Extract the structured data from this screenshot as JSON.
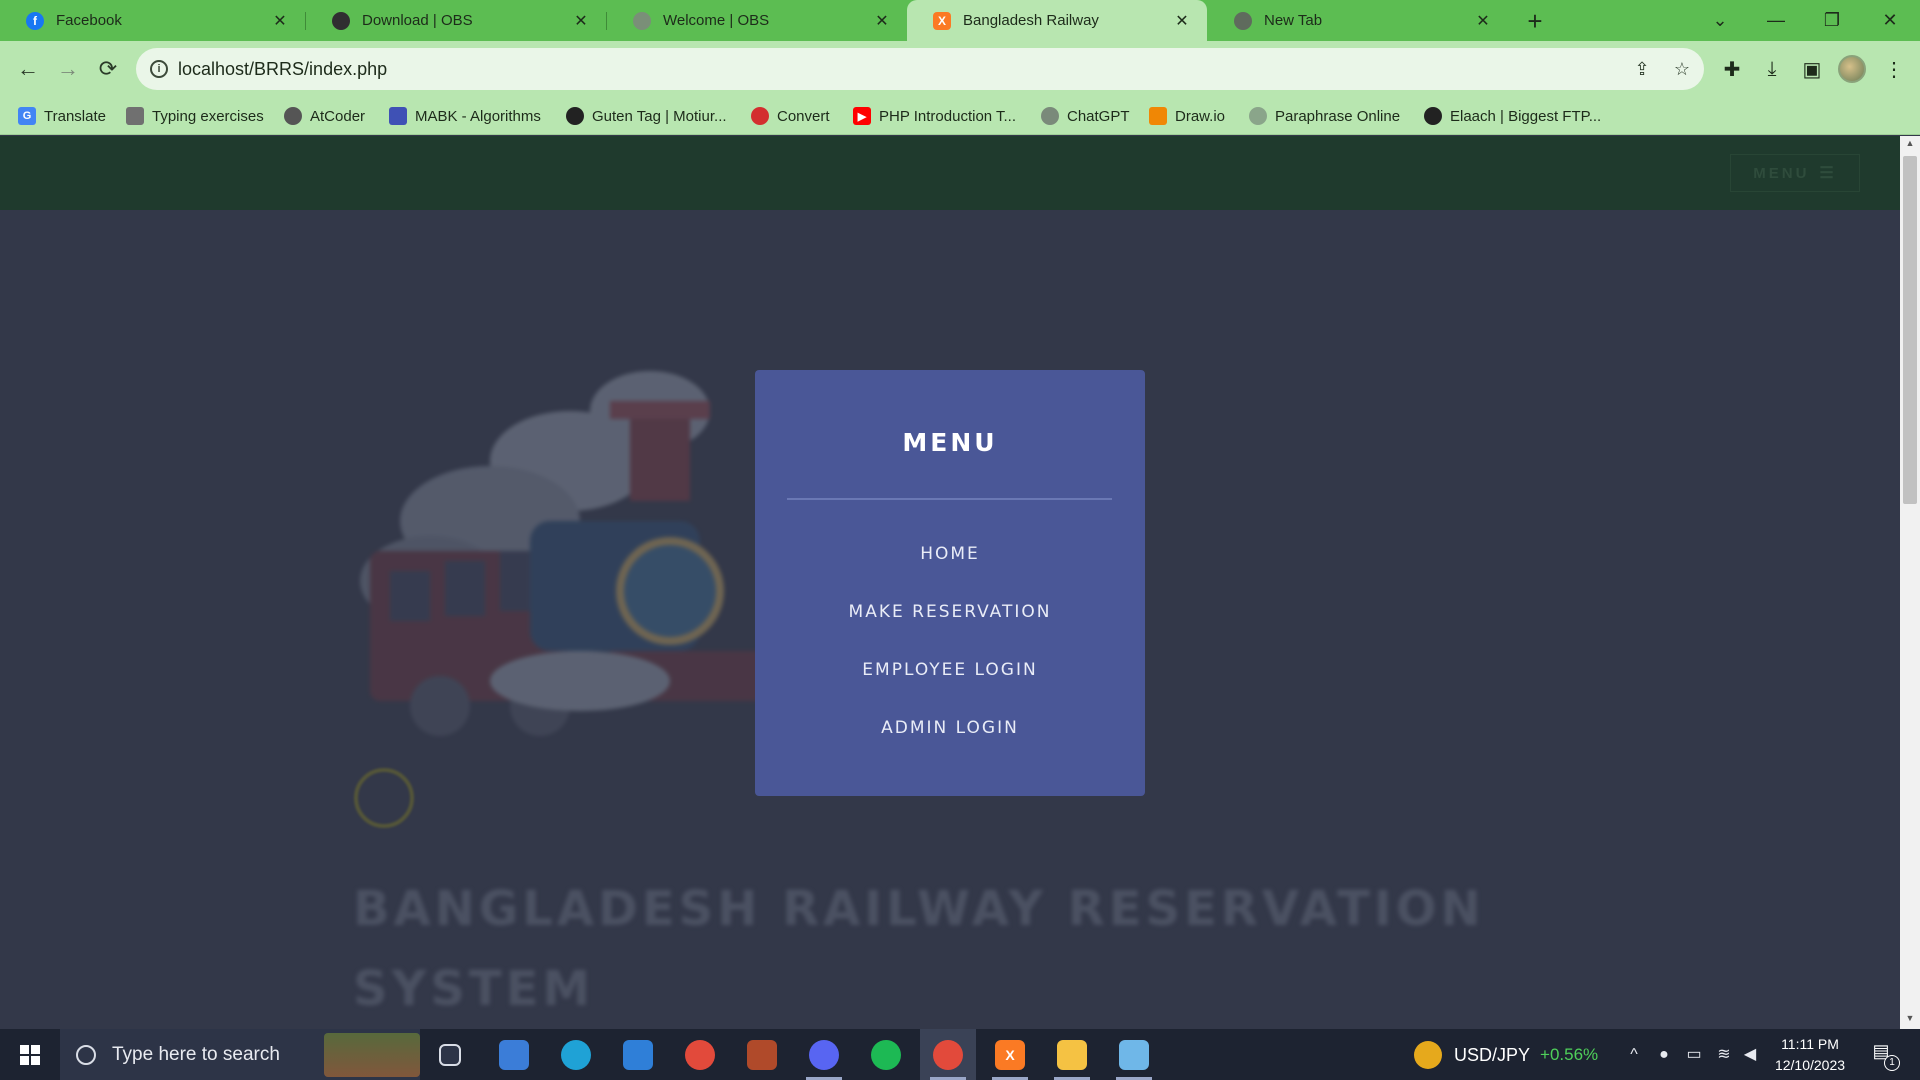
{
  "browser": {
    "tabs": [
      {
        "title": "Facebook",
        "icon": "facebook-icon",
        "color": "#1877f2"
      },
      {
        "title": "Download | OBS",
        "icon": "obs-icon",
        "color": "#302e31"
      },
      {
        "title": "Welcome | OBS",
        "icon": "obs-icon",
        "color": "#7a8f78"
      },
      {
        "title": "Bangladesh Railway",
        "icon": "xampp-icon",
        "color": "#fb7a24",
        "active": true
      },
      {
        "title": "New Tab",
        "icon": "chrome-icon",
        "color": "#5f6b5d"
      }
    ],
    "close_glyph": "✕",
    "new_tab_glyph": "+",
    "url": "localhost/BRRS/index.php",
    "bookmarks": [
      {
        "label": "Translate",
        "icon": "google-translate-icon",
        "color": "#4285f4"
      },
      {
        "label": "Typing exercises",
        "icon": "keyboard-icon",
        "color": "#707070"
      },
      {
        "label": "AtCoder",
        "icon": "atcoder-icon",
        "color": "#555555"
      },
      {
        "label": "MABK - Algorithms",
        "icon": "blog-icon",
        "color": "#3f51b5"
      },
      {
        "label": "Guten Tag | Motiur...",
        "icon": "globe-icon",
        "color": "#222222"
      },
      {
        "label": "Convert",
        "icon": "convert-icon",
        "color": "#d32f2f"
      },
      {
        "label": "PHP Introduction T...",
        "icon": "youtube-icon",
        "color": "#ff0000"
      },
      {
        "label": "ChatGPT",
        "icon": "chatgpt-icon",
        "color": "#7a8a7a"
      },
      {
        "label": "Draw.io",
        "icon": "drawio-icon",
        "color": "#f08705"
      },
      {
        "label": "Paraphrase Online",
        "icon": "paraphrase-icon",
        "color": "#8aa58a"
      },
      {
        "label": "Elaach | Biggest FTP...",
        "icon": "globe-icon",
        "color": "#222222"
      }
    ]
  },
  "site": {
    "header_menu_label": "MENU",
    "hero_title": "BANGLADESH RAILWAY RESERVATION SYSTEM",
    "menu_panel": {
      "heading": "MENU",
      "items": [
        {
          "label": "HOME"
        },
        {
          "label": "MAKE RESERVATION"
        },
        {
          "label": "EMPLOYEE LOGIN"
        },
        {
          "label": "ADMIN LOGIN"
        }
      ],
      "panel_color": "#4a5797"
    }
  },
  "taskbar": {
    "search_placeholder": "Type here to search",
    "apps": [
      {
        "name": "task-view-icon",
        "color": "#2d3447"
      },
      {
        "name": "file-manager-icon",
        "color": "#3b7dd8"
      },
      {
        "name": "edge-icon",
        "color": "#1fa2d6"
      },
      {
        "name": "mail-icon",
        "color": "#2f7fd8"
      },
      {
        "name": "chrome-icon",
        "color": "#e24a3b"
      },
      {
        "name": "ebook-app-icon",
        "color": "#b04a2a"
      },
      {
        "name": "discord-icon",
        "color": "#5865f2"
      },
      {
        "name": "spotify-icon",
        "color": "#1db954"
      },
      {
        "name": "chrome-icon",
        "color": "#e24a3b"
      },
      {
        "name": "xampp-icon",
        "color": "#fb7a24"
      },
      {
        "name": "file-explorer-icon",
        "color": "#f5c243"
      },
      {
        "name": "notepad-icon",
        "color": "#6fb7e8"
      }
    ],
    "ticker": {
      "pair": "USD/JPY",
      "change": "+0.56%"
    },
    "time": "11:11 PM",
    "date": "12/10/2023",
    "notification_count": "1"
  }
}
